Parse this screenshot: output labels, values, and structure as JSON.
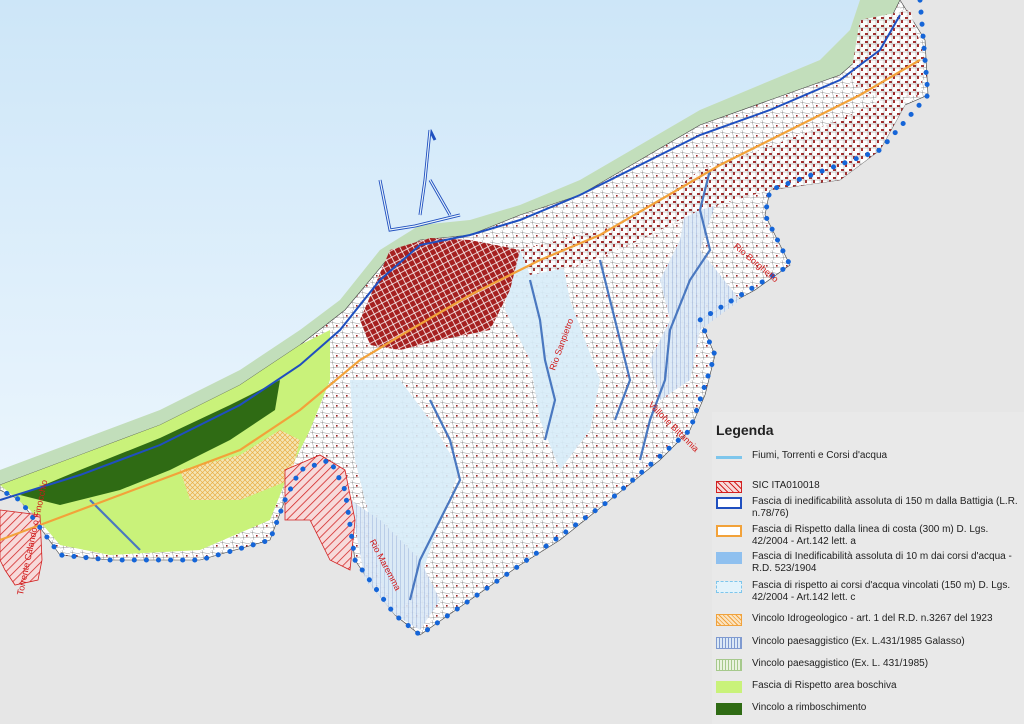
{
  "legend": {
    "title": "Legenda",
    "items": [
      {
        "label": "Fiumi, Torrenti e Corsi d'acqua",
        "kind": "line",
        "color": "#7ec6ec"
      },
      {
        "label": "SIC ITA010018",
        "kind": "hatch-red",
        "color": "#d22020"
      },
      {
        "label": "Fascia di inedificabilità assoluta di 150 m dalla Battigia (L.R. n.78/76)",
        "kind": "outline",
        "color": "#1f4fbf"
      },
      {
        "label": "Fascia di Rispetto dalla linea di costa (300 m) D. Lgs. 42/2004 - Art.142 lett. a",
        "kind": "outline",
        "color": "#f2a23a"
      },
      {
        "label": "Fascia di Inedificabilità assoluta di 10 m dai corsi d'acqua - R.D. 523/1904",
        "kind": "fill",
        "color": "#8fc0ef"
      },
      {
        "label": "Fascia di rispetto ai corsi d'acqua vincolati (150 m) D. Lgs. 42/2004 - Art.142 lett. c",
        "kind": "dashed",
        "color": "#c7e6f7"
      },
      {
        "label": "Vincolo Idrogeologico - art. 1 del R.D. n.3267 del 1923",
        "kind": "crosshatch",
        "color": "#f0a23c"
      },
      {
        "label": "Vincolo paesaggistico (Ex. L.431/1985 Galasso)",
        "kind": "vhatch",
        "color": "#7f9ad0"
      },
      {
        "label": "Vincolo paesaggistico (Ex. L. 431/1985)",
        "kind": "vhatch-green",
        "color": "#a6c98c"
      },
      {
        "label": "Fascia di Rispetto area boschiva",
        "kind": "fill",
        "color": "#c9f27a"
      },
      {
        "label": "Vincolo a rimboschimento",
        "kind": "fill",
        "color": "#2f6b14"
      }
    ]
  },
  "map_labels": [
    {
      "text": "Torrente Calando o Finocchio",
      "name": "river-label-calando"
    },
    {
      "text": "Rio Borghetto",
      "name": "river-label-borghetto"
    },
    {
      "text": "Rio Sanpietro",
      "name": "river-label-sanpietro"
    },
    {
      "text": "Vallone Bittannia",
      "name": "river-label-bittannia"
    },
    {
      "text": "Rio Maremma",
      "name": "river-label-maremma"
    }
  ]
}
